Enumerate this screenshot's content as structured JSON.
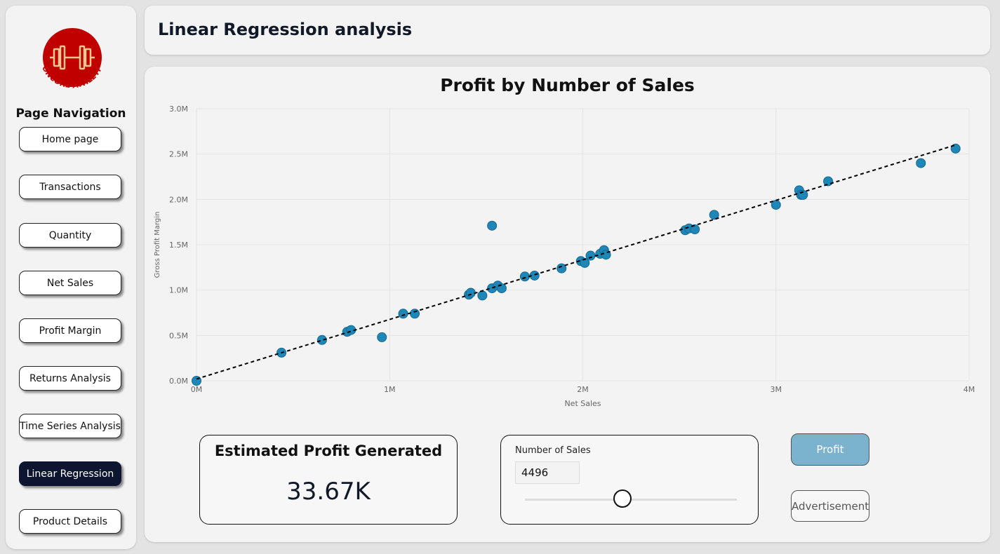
{
  "logo": {
    "text": "IRONCORE ATHLETICS",
    "color": "#c00000",
    "icon": "dumbbell-icon"
  },
  "sidebar": {
    "title": "Page Navigation",
    "items": [
      {
        "label": "Home page"
      },
      {
        "label": "Transactions"
      },
      {
        "label": "Quantity"
      },
      {
        "label": "Net Sales"
      },
      {
        "label": "Profit Margin"
      },
      {
        "label": "Returns Analysis"
      },
      {
        "label": "Time Series Analysis"
      },
      {
        "label": "Linear Regression",
        "active": true
      },
      {
        "label": "Product Details"
      }
    ]
  },
  "header": {
    "title": "Linear Regression analysis"
  },
  "kpi": {
    "title": "Estimated Profit Generated",
    "value": "33.67K"
  },
  "parameter": {
    "label": "Number of Sales",
    "value": "4496",
    "slider_position": 0.46
  },
  "buttons": {
    "profit": "Profit",
    "advertisement": "Advertisement"
  },
  "colors": {
    "accent": "#1f86b8",
    "active_nav": "#0d1531",
    "profit_button": "#7bb3cf"
  },
  "chart_data": {
    "type": "scatter",
    "title": "Profit by Number of Sales",
    "xlabel": "Net Sales",
    "ylabel": "Gross Profit Margin",
    "xlim": [
      0,
      4000000
    ],
    "ylim": [
      0,
      3000000
    ],
    "x_ticks": [
      0,
      1000000,
      2000000,
      3000000,
      4000000
    ],
    "x_tick_labels": [
      "0M",
      "1M",
      "2M",
      "3M",
      "4M"
    ],
    "y_ticks": [
      0,
      500000,
      1000000,
      1500000,
      2000000,
      2500000,
      3000000
    ],
    "y_tick_labels": [
      "0.0M",
      "0.5M",
      "1.0M",
      "1.5M",
      "2.0M",
      "2.5M",
      "3.0M"
    ],
    "grid": true,
    "trendline": {
      "style": "dashed",
      "from": [
        0,
        20000
      ],
      "to": [
        3930000,
        2600000
      ]
    },
    "points": [
      [
        0,
        0
      ],
      [
        440000,
        310000
      ],
      [
        650000,
        450000
      ],
      [
        780000,
        540000
      ],
      [
        800000,
        560000
      ],
      [
        960000,
        480000
      ],
      [
        1070000,
        740000
      ],
      [
        1130000,
        740000
      ],
      [
        1410000,
        950000
      ],
      [
        1420000,
        970000
      ],
      [
        1480000,
        940000
      ],
      [
        1530000,
        1020000
      ],
      [
        1560000,
        1050000
      ],
      [
        1580000,
        1020000
      ],
      [
        1530000,
        1710000
      ],
      [
        1700000,
        1150000
      ],
      [
        1750000,
        1160000
      ],
      [
        1890000,
        1240000
      ],
      [
        1990000,
        1320000
      ],
      [
        2010000,
        1300000
      ],
      [
        2040000,
        1380000
      ],
      [
        2090000,
        1400000
      ],
      [
        2110000,
        1440000
      ],
      [
        2120000,
        1390000
      ],
      [
        2530000,
        1660000
      ],
      [
        2550000,
        1680000
      ],
      [
        2580000,
        1670000
      ],
      [
        2680000,
        1830000
      ],
      [
        3000000,
        1940000
      ],
      [
        3120000,
        2100000
      ],
      [
        3130000,
        2050000
      ],
      [
        3140000,
        2050000
      ],
      [
        3270000,
        2200000
      ],
      [
        3750000,
        2400000
      ],
      [
        3930000,
        2560000
      ]
    ]
  }
}
